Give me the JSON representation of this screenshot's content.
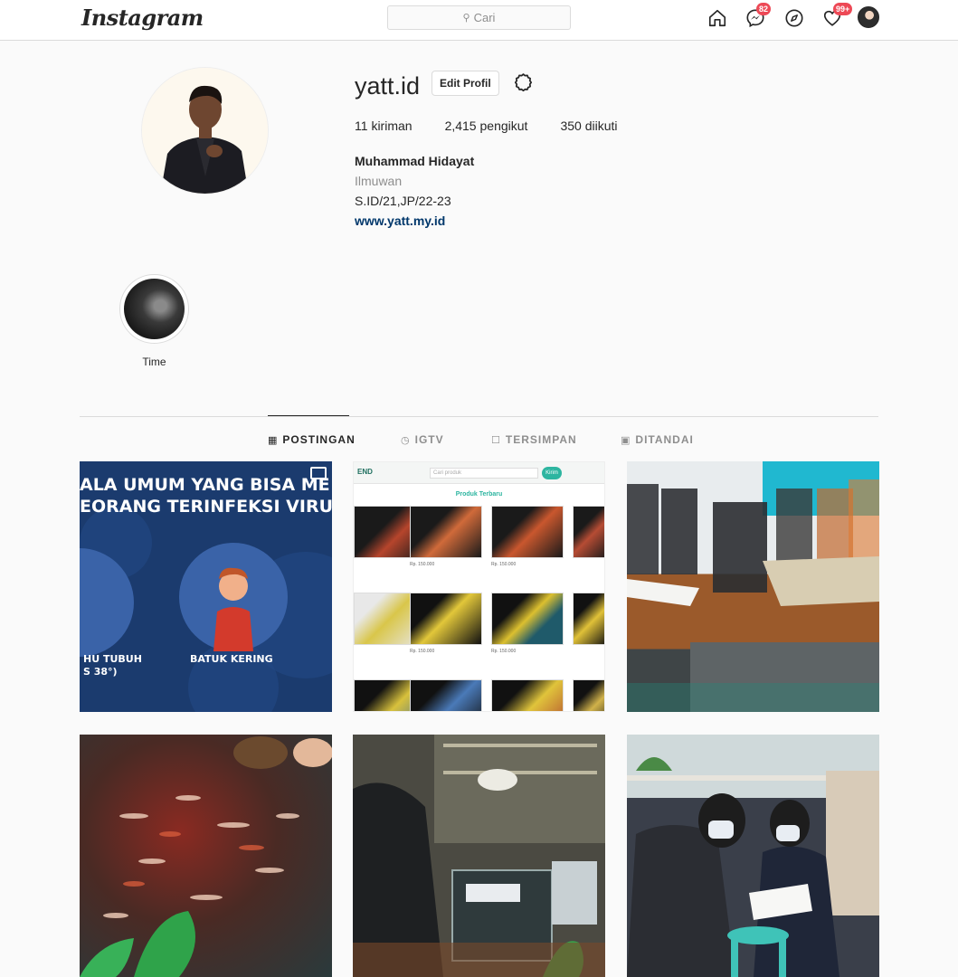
{
  "topbar": {
    "logo": "Instagram",
    "search_placeholder": "Cari",
    "messenger_badge": "82",
    "activity_badge": "99+"
  },
  "profile": {
    "username": "yatt.id",
    "edit_label": "Edit Profil",
    "stats": [
      {
        "value": "11",
        "label": "kiriman"
      },
      {
        "value": "2,415",
        "label": "pengikut"
      },
      {
        "value": "350",
        "label": "diikuti"
      }
    ],
    "full_name": "Muhammad Hidayat",
    "category": "Ilmuwan",
    "bio": "S.ID/21,JP/22-23",
    "website": "www.yatt.my.id"
  },
  "highlights": [
    {
      "label": "Time"
    }
  ],
  "tabs": [
    {
      "label": "POSTINGAN",
      "icon": "grid-icon",
      "active": true
    },
    {
      "label": "IGTV",
      "icon": "igtv-icon",
      "active": false
    },
    {
      "label": "TERSIMPAN",
      "icon": "bookmark-icon",
      "active": false
    },
    {
      "label": "DITANDAI",
      "icon": "tagged-icon",
      "active": false
    }
  ],
  "posts": {
    "p1": {
      "line1": "ALA UMUM YANG BISA ME",
      "line2": "EORANG TERINFEKSI VIRUS",
      "label_left": "HU TUBUH",
      "label_left2": "S 38°)",
      "label_right": "BATUK KERING"
    },
    "p2": {
      "logo": "END",
      "search": "Cari produk",
      "button": "Kirim",
      "title": "Produk Terbaru",
      "price": "Rp. 150.000"
    }
  },
  "colors": {
    "accent_link": "#00376b",
    "badge": "#ed4956",
    "border": "#dbdbdb",
    "muted": "#8e8e8e"
  }
}
